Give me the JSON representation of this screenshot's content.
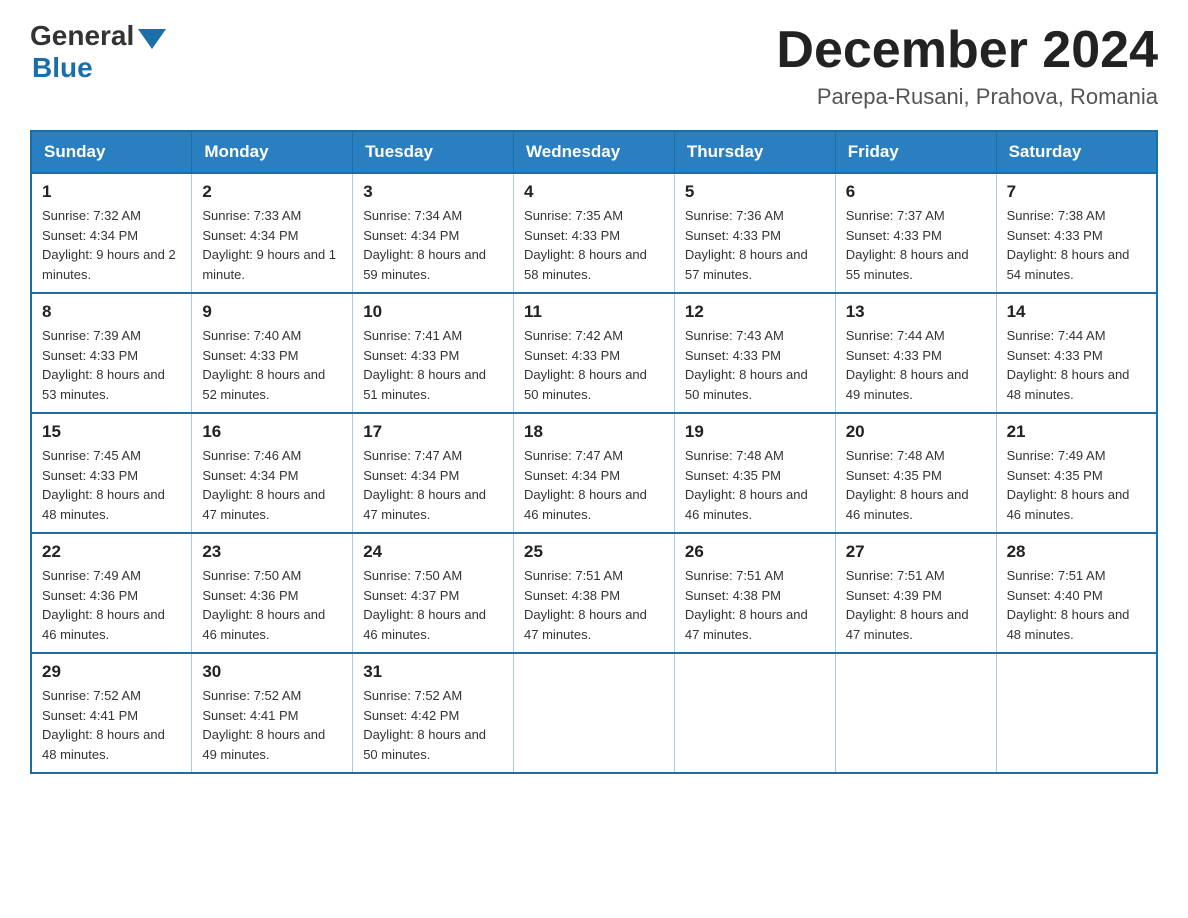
{
  "header": {
    "logo_general": "General",
    "logo_blue": "Blue",
    "month_title": "December 2024",
    "location": "Parepa-Rusani, Prahova, Romania"
  },
  "days_of_week": [
    "Sunday",
    "Monday",
    "Tuesday",
    "Wednesday",
    "Thursday",
    "Friday",
    "Saturday"
  ],
  "weeks": [
    [
      {
        "day": "1",
        "sunrise": "7:32 AM",
        "sunset": "4:34 PM",
        "daylight": "9 hours and 2 minutes."
      },
      {
        "day": "2",
        "sunrise": "7:33 AM",
        "sunset": "4:34 PM",
        "daylight": "9 hours and 1 minute."
      },
      {
        "day": "3",
        "sunrise": "7:34 AM",
        "sunset": "4:34 PM",
        "daylight": "8 hours and 59 minutes."
      },
      {
        "day": "4",
        "sunrise": "7:35 AM",
        "sunset": "4:33 PM",
        "daylight": "8 hours and 58 minutes."
      },
      {
        "day": "5",
        "sunrise": "7:36 AM",
        "sunset": "4:33 PM",
        "daylight": "8 hours and 57 minutes."
      },
      {
        "day": "6",
        "sunrise": "7:37 AM",
        "sunset": "4:33 PM",
        "daylight": "8 hours and 55 minutes."
      },
      {
        "day": "7",
        "sunrise": "7:38 AM",
        "sunset": "4:33 PM",
        "daylight": "8 hours and 54 minutes."
      }
    ],
    [
      {
        "day": "8",
        "sunrise": "7:39 AM",
        "sunset": "4:33 PM",
        "daylight": "8 hours and 53 minutes."
      },
      {
        "day": "9",
        "sunrise": "7:40 AM",
        "sunset": "4:33 PM",
        "daylight": "8 hours and 52 minutes."
      },
      {
        "day": "10",
        "sunrise": "7:41 AM",
        "sunset": "4:33 PM",
        "daylight": "8 hours and 51 minutes."
      },
      {
        "day": "11",
        "sunrise": "7:42 AM",
        "sunset": "4:33 PM",
        "daylight": "8 hours and 50 minutes."
      },
      {
        "day": "12",
        "sunrise": "7:43 AM",
        "sunset": "4:33 PM",
        "daylight": "8 hours and 50 minutes."
      },
      {
        "day": "13",
        "sunrise": "7:44 AM",
        "sunset": "4:33 PM",
        "daylight": "8 hours and 49 minutes."
      },
      {
        "day": "14",
        "sunrise": "7:44 AM",
        "sunset": "4:33 PM",
        "daylight": "8 hours and 48 minutes."
      }
    ],
    [
      {
        "day": "15",
        "sunrise": "7:45 AM",
        "sunset": "4:33 PM",
        "daylight": "8 hours and 48 minutes."
      },
      {
        "day": "16",
        "sunrise": "7:46 AM",
        "sunset": "4:34 PM",
        "daylight": "8 hours and 47 minutes."
      },
      {
        "day": "17",
        "sunrise": "7:47 AM",
        "sunset": "4:34 PM",
        "daylight": "8 hours and 47 minutes."
      },
      {
        "day": "18",
        "sunrise": "7:47 AM",
        "sunset": "4:34 PM",
        "daylight": "8 hours and 46 minutes."
      },
      {
        "day": "19",
        "sunrise": "7:48 AM",
        "sunset": "4:35 PM",
        "daylight": "8 hours and 46 minutes."
      },
      {
        "day": "20",
        "sunrise": "7:48 AM",
        "sunset": "4:35 PM",
        "daylight": "8 hours and 46 minutes."
      },
      {
        "day": "21",
        "sunrise": "7:49 AM",
        "sunset": "4:35 PM",
        "daylight": "8 hours and 46 minutes."
      }
    ],
    [
      {
        "day": "22",
        "sunrise": "7:49 AM",
        "sunset": "4:36 PM",
        "daylight": "8 hours and 46 minutes."
      },
      {
        "day": "23",
        "sunrise": "7:50 AM",
        "sunset": "4:36 PM",
        "daylight": "8 hours and 46 minutes."
      },
      {
        "day": "24",
        "sunrise": "7:50 AM",
        "sunset": "4:37 PM",
        "daylight": "8 hours and 46 minutes."
      },
      {
        "day": "25",
        "sunrise": "7:51 AM",
        "sunset": "4:38 PM",
        "daylight": "8 hours and 47 minutes."
      },
      {
        "day": "26",
        "sunrise": "7:51 AM",
        "sunset": "4:38 PM",
        "daylight": "8 hours and 47 minutes."
      },
      {
        "day": "27",
        "sunrise": "7:51 AM",
        "sunset": "4:39 PM",
        "daylight": "8 hours and 47 minutes."
      },
      {
        "day": "28",
        "sunrise": "7:51 AM",
        "sunset": "4:40 PM",
        "daylight": "8 hours and 48 minutes."
      }
    ],
    [
      {
        "day": "29",
        "sunrise": "7:52 AM",
        "sunset": "4:41 PM",
        "daylight": "8 hours and 48 minutes."
      },
      {
        "day": "30",
        "sunrise": "7:52 AM",
        "sunset": "4:41 PM",
        "daylight": "8 hours and 49 minutes."
      },
      {
        "day": "31",
        "sunrise": "7:52 AM",
        "sunset": "4:42 PM",
        "daylight": "8 hours and 50 minutes."
      },
      null,
      null,
      null,
      null
    ]
  ]
}
